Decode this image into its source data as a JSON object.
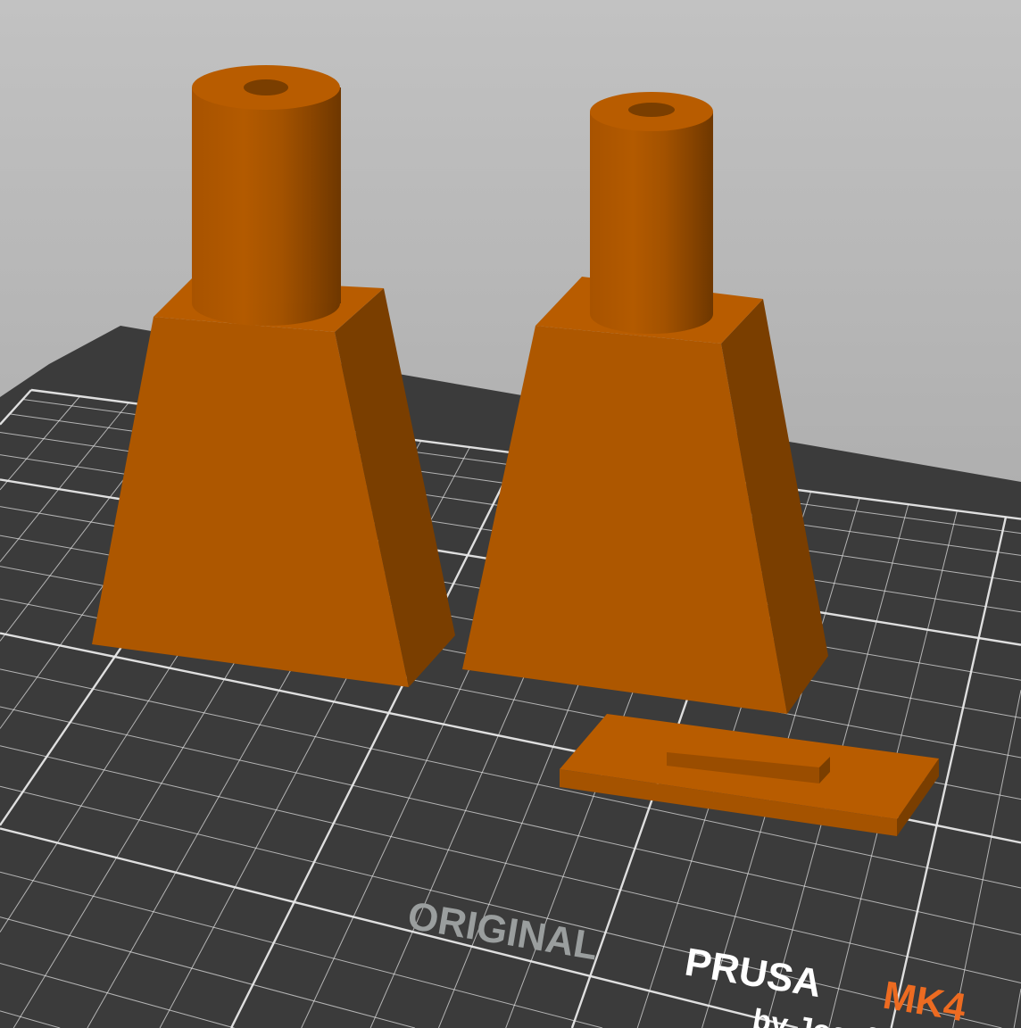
{
  "viewport": {
    "bed_logo": {
      "line1_gray": "ORIGINAL",
      "line1_white": "PRUSA",
      "line1_model": "MK4",
      "line2": "by Josef P"
    },
    "objects": [
      {
        "name": "left-stand"
      },
      {
        "name": "right-stand"
      },
      {
        "name": "flat-plate"
      }
    ]
  },
  "colors": {
    "background_top": "#c2c2c2",
    "background_bottom": "#9a9a9a",
    "bed": "#3b3b3b",
    "grid": "#e8e8e8",
    "object_front": "#ad5700",
    "object_side": "#7a3e00",
    "object_top": "#b85c00",
    "logo_gray": "#9a9e9e",
    "logo_white": "#ffffff",
    "logo_orange": "#ed6b21"
  }
}
